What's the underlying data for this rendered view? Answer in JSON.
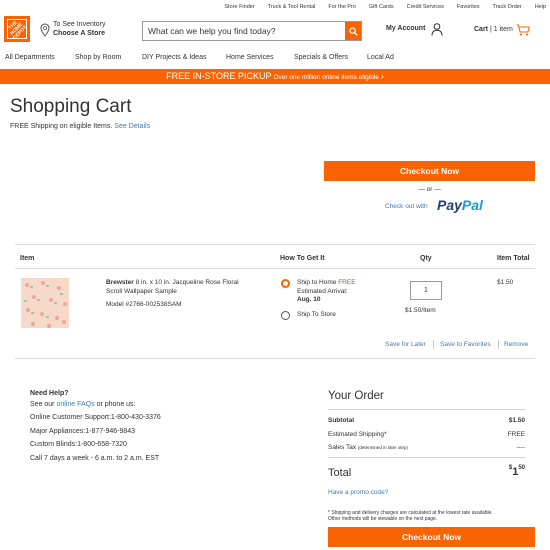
{
  "brand": {
    "logo_text": "THE HOME DEPOT",
    "accent": "#f96302",
    "link_color": "#3e7bb6",
    "success": "#3d8e1c"
  },
  "utility_nav": [
    "Store Finder",
    "Truck & Tool Rental",
    "For the Pro",
    "Gift Cards",
    "Credit Services",
    "Favorites",
    "Track Order",
    "Help"
  ],
  "header": {
    "store_line1": "To See Inventory",
    "store_line2": "Choose A Store",
    "search_placeholder": "What can we help you find today?",
    "account_label": "My Account",
    "cart_label": "Cart",
    "cart_count": "1 item"
  },
  "main_nav": [
    "All Departments",
    "Shop by Room",
    "DIY Projects & Ideas",
    "Home Services",
    "Specials & Offers",
    "Local Ad"
  ],
  "promo_bar": {
    "headline": "FREE IN-STORE PICKUP",
    "sub": "Over one million online items eligible"
  },
  "page": {
    "title": "Shopping Cart",
    "free_shipping_text": "FREE Shipping on eligible Items.",
    "see_details": "See Details",
    "checkout_label": "Checkout Now",
    "or_text": "— or —",
    "checkout_with": "Check out with",
    "paypal_part1": "Pay",
    "paypal_part2": "Pal"
  },
  "table": {
    "headers": {
      "item": "Item",
      "how": "How To Get It",
      "qty": "Qty",
      "total": "Item Total"
    },
    "row": {
      "brand": "Brewster",
      "name": "8 in. x 10 in. Jacqueline Rose Floral Scroll Wallpaper Sample",
      "model": "Model #2766-002538SAM",
      "ship_home": "Ship to Home",
      "ship_home_badge": "FREE",
      "arrival_label": "Estimated Arrival:",
      "arrival_date": "Aug. 10",
      "ship_store": "Ship To Store",
      "qty": "1",
      "unit_price": "$1.50/Item",
      "item_total": "$1.50",
      "save_later": "Save for Later",
      "save_fav": "Save to Favorites",
      "remove": "Remove"
    }
  },
  "help": {
    "title": "Need Help?",
    "see_our": "See our",
    "faq_link": "online FAQs",
    "or_phone": "or phone us:",
    "support": "Online Customer Support:1-800-430-3376",
    "appliances": "Major Appliances:1-877-946-9843",
    "blinds": "Custom Blinds:1-800-658-7320",
    "hours": "Call 7 days a week - 6 a.m. to 2 a.m. EST"
  },
  "order": {
    "title": "Your Order",
    "subtotal_label": "Subtotal",
    "subtotal_value": "$1.50",
    "shipping_label": "Estimated Shipping*",
    "shipping_value": "FREE",
    "tax_label": "Sales Tax",
    "tax_note": "(determined in later step)",
    "tax_value": "----",
    "total_label": "Total",
    "total_dollar": "$",
    "total_main": "1",
    "total_cents": "50",
    "promo_link": "Have a promo code?",
    "note_line1": "* Shipping and delivery charges are calculated at the lowest rate available.",
    "note_line2": "Other methods will be viewable on the next page.",
    "checkout_label": "Checkout Now"
  }
}
